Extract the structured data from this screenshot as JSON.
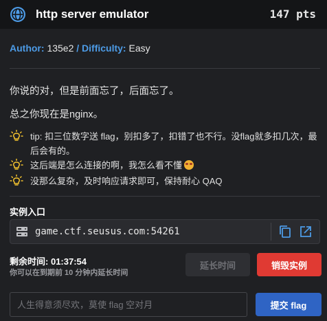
{
  "header": {
    "icon": "globe-icon",
    "title": "http server emulator",
    "points": "147 pts"
  },
  "meta": {
    "author_key": "Author:",
    "author_value": "135e2",
    "sep": "/",
    "difficulty_key": "Difficulty:",
    "difficulty_value": "Easy"
  },
  "description": {
    "line1": "你说的对，但是前面忘了，后面忘了。",
    "line2": "总之你现在是nginx。",
    "tips": [
      "tip: 扣三位数字送 flag，别扣多了，扣错了也不行。没flag就多扣几次，最后会有的。",
      "这后端是怎么连接的啊，我怎么看不懂",
      "没那么复杂，及时响应请求即可，保持耐心 QAQ"
    ]
  },
  "instance": {
    "label": "实例入口",
    "address": "game.ctf.seusus.com:54261"
  },
  "timer": {
    "label": "剩余时间:",
    "value": "01:37:54",
    "hint": "你可以在到期前 10 分钟内延长时间"
  },
  "buttons": {
    "extend": "延长时间",
    "destroy": "销毁实例",
    "submit": "提交 flag"
  },
  "flag_input": {
    "placeholder": "人生得意须尽欢，莫使 flag 空对月",
    "value": ""
  },
  "colors": {
    "accent": "#4d9be6",
    "danger": "#e03a33",
    "primary": "#2f64c4",
    "bulb": "#f2c12e"
  }
}
